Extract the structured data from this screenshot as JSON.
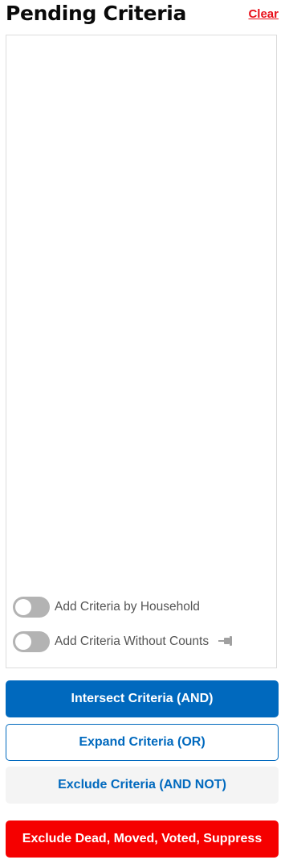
{
  "header": {
    "title": "Pending Criteria",
    "clear_label": "Clear"
  },
  "toggles": {
    "household": {
      "label": "Add Criteria by Household",
      "enabled": false
    },
    "without_counts": {
      "label": "Add Criteria Without Counts",
      "enabled": false,
      "icon": "pin-icon"
    }
  },
  "actions": {
    "intersect_label": "Intersect Criteria (AND)",
    "expand_label": "Expand Criteria (OR)",
    "exclude_label": "Exclude Criteria (AND NOT)",
    "suppress_label": "Exclude Dead, Moved, Voted, Suppress"
  },
  "colors": {
    "primary_blue": "#0069be",
    "danger_red": "#f50000",
    "link_red": "#e8101a",
    "toggle_off": "#b3b3b3"
  }
}
